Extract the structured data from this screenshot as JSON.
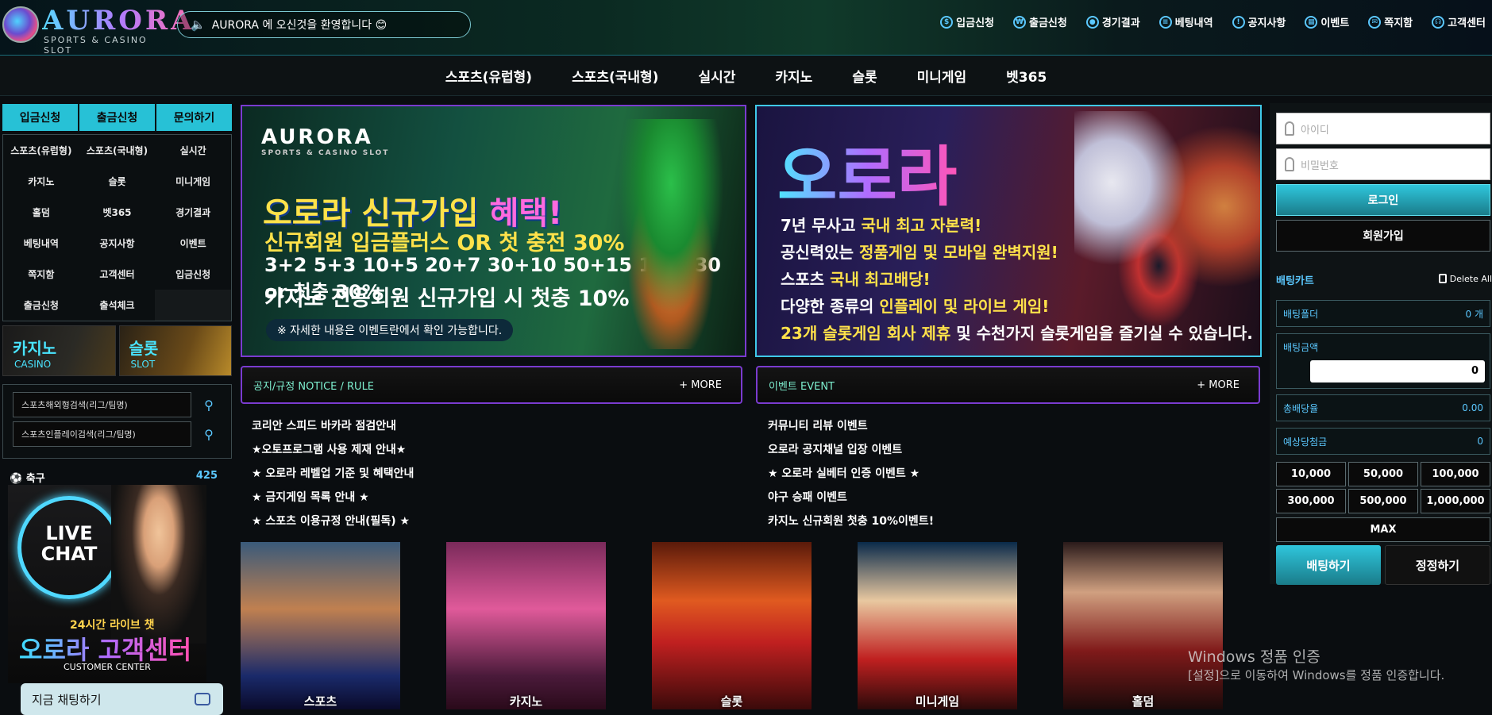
{
  "brand": {
    "name": "AURORA",
    "tagline": "SPORTS & CASINO SLOT"
  },
  "marquee": "AURORA 에 오신것을 환영합니다 😊",
  "topnav": [
    {
      "label": "입금신청",
      "icon": "dollar-icon"
    },
    {
      "label": "출금신청",
      "icon": "moneybag-icon"
    },
    {
      "label": "경기결과",
      "icon": "soccer-ball-icon"
    },
    {
      "label": "베팅내역",
      "icon": "clipboard-icon"
    },
    {
      "label": "공지사항",
      "icon": "notice-icon"
    },
    {
      "label": "이벤트",
      "icon": "calendar-icon"
    },
    {
      "label": "쪽지함",
      "icon": "envelope-icon"
    },
    {
      "label": "고객센터",
      "icon": "headset-icon"
    }
  ],
  "mainnav": [
    "스포츠(유럽형)",
    "스포츠(국내형)",
    "실시간",
    "카지노",
    "슬롯",
    "미니게임",
    "벳365"
  ],
  "left": {
    "tabs": [
      "입금신청",
      "출금신청",
      "문의하기"
    ],
    "menu": [
      "스포츠(유럽형)",
      "스포츠(국내형)",
      "실시간",
      "카지노",
      "슬롯",
      "미니게임",
      "홀덤",
      "벳365",
      "경기결과",
      "베팅내역",
      "공지사항",
      "이벤트",
      "쪽지함",
      "고객센터",
      "입금신청",
      "출금신청",
      "출석체크"
    ],
    "promos": [
      {
        "big": "카지노",
        "small": "CASINO"
      },
      {
        "big": "슬롯",
        "small": "SLOT"
      }
    ],
    "search": [
      "스포츠해외형검색(리그/팀명)",
      "스포츠인플레이검색(리그/팀명)"
    ],
    "sport": {
      "name": "축구",
      "count": "425"
    },
    "livechat": {
      "badge": "LIVE CHAT",
      "hours": "24시간 라이브 챗",
      "title": "오로라 고객센터",
      "sub": "CUSTOMER CENTER",
      "button": "지금 채팅하기"
    }
  },
  "banner1": {
    "headline_a": "오로라 신규가입 ",
    "headline_b": "혜택!",
    "line1": "신규회원 입금플러스 OR 첫 충전 30%",
    "line2": "3+2 5+3 10+5 20+7 30+10 50+15 100+30 or 첫충 30%",
    "line3": "카지노 전용회원 신규가입 시 첫충 10%",
    "note": "※ 자세한 내용은 이벤트란에서 확인 가능합니다."
  },
  "banner2": {
    "headline": "오로라",
    "l1a": "7년 무사고 ",
    "l1b": "국내 최고 자본력!",
    "l2a": "공신력있는 ",
    "l2b": "정품게임 및 모바일 완벽지원!",
    "l3a": "스포츠 ",
    "l3b": "국내 최고배당!",
    "l4a": "다양한 종류의 ",
    "l4b": "인플레이 및 라이브 게임!",
    "l5a": "23개 슬롯게임 회사 제휴",
    "l5b": " 및 수천가지 슬롯게임을 즐기실 수 있습니다."
  },
  "notice": {
    "title": "공지/규정 NOTICE / RULE",
    "more": "+ MORE",
    "items": [
      "코리안 스피드 바카라 점검안내",
      "★오토프로그램 사용 제재 안내★",
      "★ 오로라 레벨업 기준 및 혜택안내",
      "★ 금지게임 목록 안내 ★",
      "★ 스포츠 이용규정 안내(필독) ★"
    ]
  },
  "event": {
    "title": "이벤트 EVENT",
    "more": "+ MORE",
    "items": [
      "커뮤니티 리뷰 이벤트",
      "오로라 공지채널 입장 이벤트",
      "★ 오로라 실베터 인증 이벤트 ★",
      "야구 승패 이벤트",
      "카지노 신규회원 첫충 10%이벤트!"
    ]
  },
  "games": [
    "스포츠",
    "카지노",
    "슬롯",
    "미니게임",
    "홀덤"
  ],
  "watermark": {
    "line1": "Windows 정품 인증",
    "line2": "[설정]으로 이동하여 Windows를 정품 인증합니다."
  },
  "right": {
    "id_placeholder": "아이디",
    "pw_placeholder": "비밀번호",
    "login": "로그인",
    "join": "회원가입",
    "cart_title": "배팅카트",
    "delete_all": "Delete All",
    "folder_label": "배팅폴더",
    "folder_value": "0 개",
    "amount_label": "배팅금액",
    "amount_value": "0",
    "odds_label": "총배당율",
    "odds_value": "0.00",
    "payout_label": "예상당첨금",
    "payout_value": "0",
    "chips": [
      "10,000",
      "50,000",
      "100,000",
      "300,000",
      "500,000",
      "1,000,000"
    ],
    "max": "MAX",
    "bet": "배팅하기",
    "reset": "정정하기"
  }
}
